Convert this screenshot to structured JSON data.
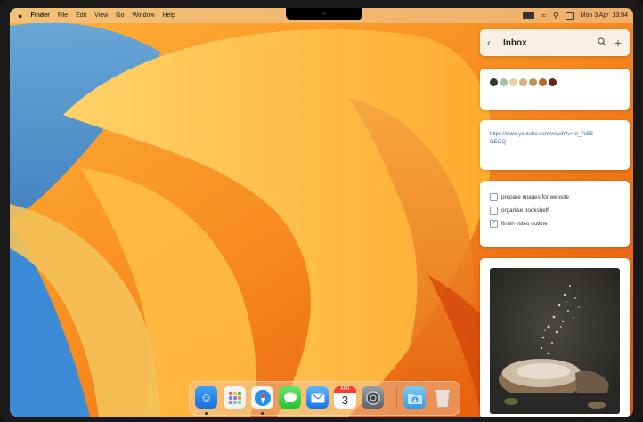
{
  "menubar": {
    "apple": "",
    "app_name": "Finder",
    "menus": [
      "File",
      "Edit",
      "View",
      "Go",
      "Window",
      "Help"
    ],
    "clock": "Mon 3 Apr  13:04"
  },
  "notes_panel": {
    "header": {
      "title": "Inbox"
    },
    "palette": {
      "colors": [
        "#2f3a26",
        "#a9c2a2",
        "#e9cfa6",
        "#d8b17f",
        "#b7955d",
        "#b86a2c",
        "#6b2320"
      ]
    },
    "link": {
      "url": "https://www.youtube.com/watch?v=fo_7o5SOEOQ"
    },
    "todos": [
      {
        "label": "prepare images for website",
        "checked": false
      },
      {
        "label": "organise bookshelf",
        "checked": false
      },
      {
        "label": "finish video outline",
        "checked": true
      }
    ]
  },
  "dock": {
    "calendar_month": "APR",
    "calendar_day": "3",
    "apps": [
      "finder",
      "launchpad",
      "safari",
      "messages",
      "mail",
      "calendar",
      "system-settings",
      "downloads",
      "trash"
    ]
  }
}
